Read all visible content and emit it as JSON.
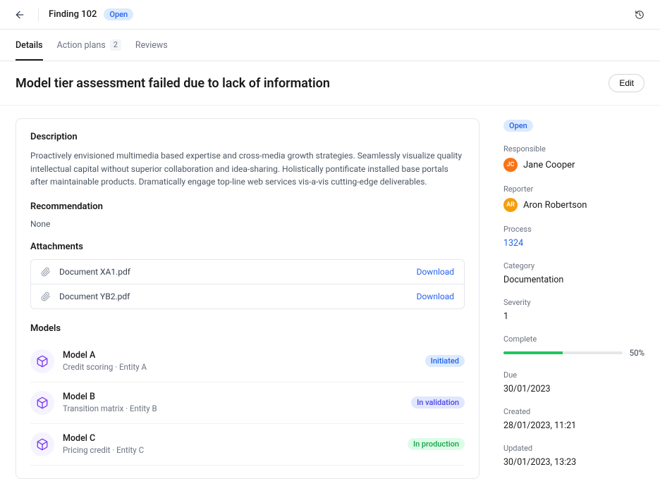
{
  "topbar": {
    "title": "Finding 102",
    "status": "Open"
  },
  "tabs": {
    "details": "Details",
    "action_plans": {
      "label": "Action plans",
      "count": "2"
    },
    "reviews": "Reviews"
  },
  "header": {
    "title": "Model tier assessment failed due to lack of information",
    "edit": "Edit"
  },
  "card": {
    "description_h": "Description",
    "description": "Proactively envisioned multimedia based expertise and cross-media growth strategies. Seamlessly visualize quality intellectual capital without superior collaboration and idea-sharing. Holistically pontificate installed base portals after maintainable products. Dramatically engage top-line web services vis-a-vis cutting-edge deliverables.",
    "recommendation_h": "Recommendation",
    "recommendation": "None",
    "attachments_h": "Attachments",
    "download": "Download",
    "attachments": [
      {
        "name": "Document XA1.pdf"
      },
      {
        "name": "Document YB2.pdf"
      }
    ],
    "models_h": "Models",
    "models": [
      {
        "name": "Model A",
        "sub": "Credit scoring · Entity A",
        "status": "Initiated",
        "pill": "pill-blue"
      },
      {
        "name": "Model B",
        "sub": "Transition matrix · Entity B",
        "status": "In validation",
        "pill": "pill-violet"
      },
      {
        "name": "Model C",
        "sub": "Pricing credit · Entity C",
        "status": "In production",
        "pill": "pill-green"
      }
    ]
  },
  "side": {
    "status": "Open",
    "responsible_lbl": "Responsible",
    "responsible": {
      "initials": "JC",
      "name": "Jane Cooper"
    },
    "reporter_lbl": "Reporter",
    "reporter": {
      "initials": "AR",
      "name": "Aron Robertson"
    },
    "process_lbl": "Process",
    "process": "1324",
    "category_lbl": "Category",
    "category": "Documentation",
    "severity_lbl": "Severity",
    "severity": "1",
    "complete_lbl": "Complete",
    "complete_pct": "50%",
    "complete_pct_num": 50,
    "due_lbl": "Due",
    "due": "30/01/2023",
    "created_lbl": "Created",
    "created": "28/01/2023, 11:21",
    "updated_lbl": "Updated",
    "updated": "30/01/2023, 13:23"
  }
}
